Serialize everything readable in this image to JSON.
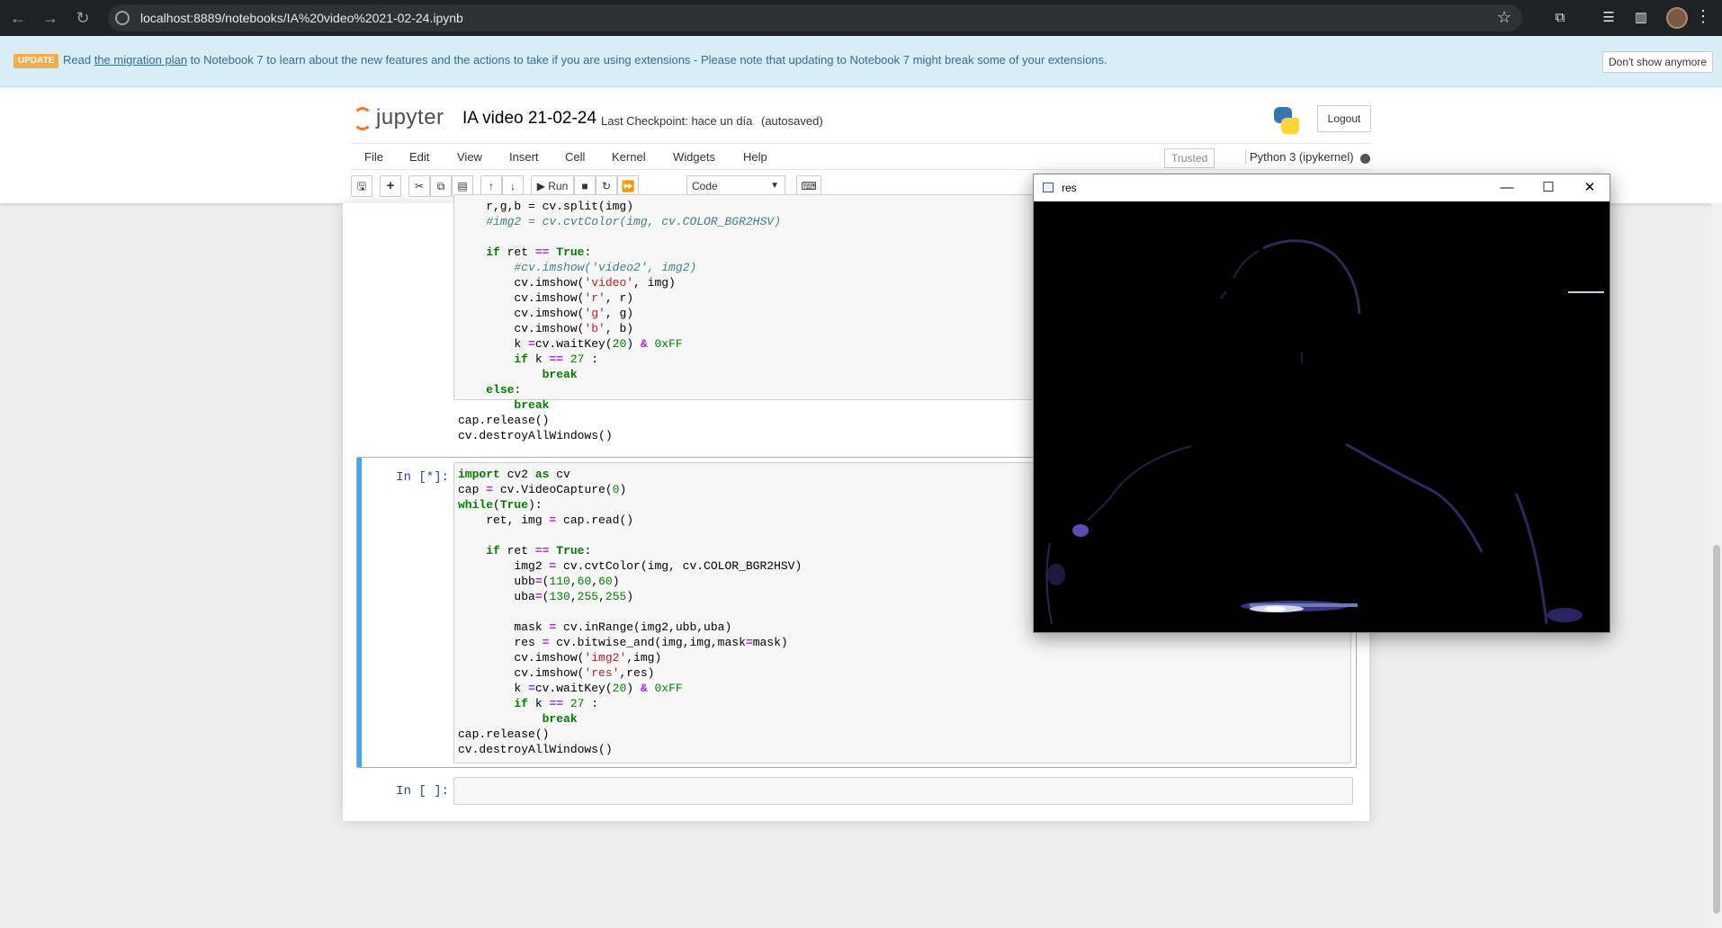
{
  "browser": {
    "url": "localhost:8889/notebooks/IA%20video%2021-02-24.ipynb"
  },
  "banner": {
    "badge": "UPDATE",
    "read": "Read",
    "link": "the migration plan",
    "text": "to Notebook 7 to learn about the new features and the actions to take if you are using extensions - Please note that updating to Notebook 7 might break some of your extensions.",
    "dismiss": "Don't show anymore"
  },
  "header": {
    "logo_text": "jupyter",
    "title": "IA video 21-02-24",
    "checkpoint": "Last Checkpoint: hace un día",
    "autosaved": "(autosaved)",
    "logout": "Logout"
  },
  "menu": {
    "items": [
      "File",
      "Edit",
      "View",
      "Insert",
      "Cell",
      "Kernel",
      "Widgets",
      "Help"
    ],
    "trusted": "Trusted",
    "kernel": "Python 3 (ipykernel)"
  },
  "toolbar": {
    "run": "Run",
    "cell_type": "Code"
  },
  "cells": {
    "prompt_running": "In [*]:",
    "prompt_empty": "In [ ]:"
  },
  "window": {
    "title": "res"
  },
  "colors": {
    "selected_cell_border": "#42a5f5",
    "prompt": "#303f9f",
    "logo_orange": "#f37726"
  }
}
